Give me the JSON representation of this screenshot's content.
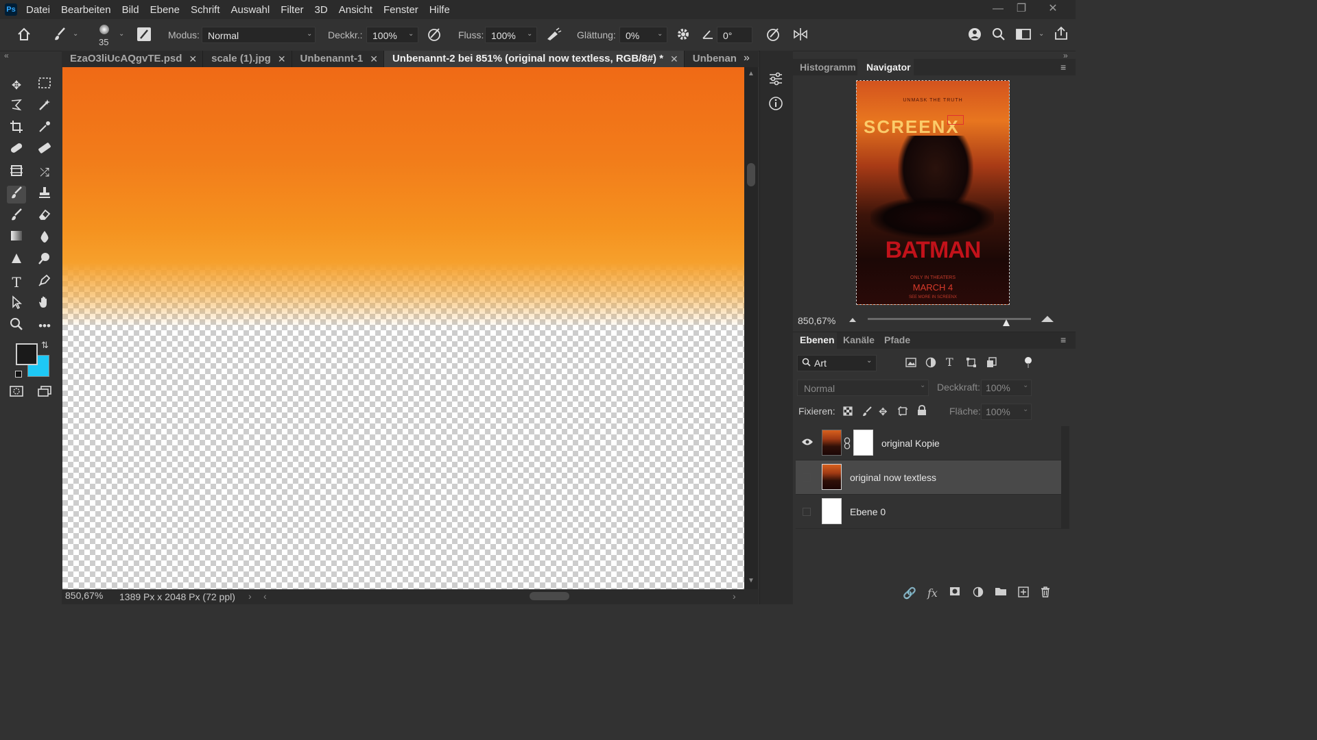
{
  "menu": {
    "app_logo": "Ps",
    "items": [
      "Datei",
      "Bearbeiten",
      "Bild",
      "Ebene",
      "Schrift",
      "Auswahl",
      "Filter",
      "3D",
      "Ansicht",
      "Fenster",
      "Hilfe"
    ]
  },
  "options": {
    "brush_size": "35",
    "mode_label": "Modus:",
    "mode_value": "Normal",
    "opacity_label": "Deckkr.:",
    "opacity_value": "100%",
    "flow_label": "Fluss:",
    "flow_value": "100%",
    "smoothing_label": "Glättung:",
    "smoothing_value": "0%",
    "angle_value": "0°"
  },
  "tabs": [
    {
      "label": "EzaO3liUcAQgvTE.psd"
    },
    {
      "label": "scale (1).jpg"
    },
    {
      "label": "Unbenannt-1"
    },
    {
      "label": "Unbenannt-2 bei 851% (original now textless, RGB/8#) *"
    },
    {
      "label": "Unbenan"
    }
  ],
  "status": {
    "zoom": "850,67%",
    "doc_size": "1389 Px x 2048 Px (72 ppl)"
  },
  "navigator": {
    "tab_histogram": "Histogramm",
    "tab_navigator": "Navigator",
    "zoom": "850,67%",
    "zoom_level": 0.85,
    "poster_text": {
      "tagline": "UNMASK THE TRUTH",
      "brand": "SCREENX",
      "title": "BATMAN",
      "subtitle": "ONLY IN THEATERS",
      "date": "MARCH 4",
      "footer": "SEE MORE IN SCREENX"
    }
  },
  "layers": {
    "tab_layers": "Ebenen",
    "tab_channels": "Kanäle",
    "tab_paths": "Pfade",
    "filter_kind": "Art",
    "blend_mode": "Normal",
    "opacity_label": "Deckkraft:",
    "opacity_value": "100%",
    "lock_label": "Fixieren:",
    "fill_label": "Fläche:",
    "fill_value": "100%",
    "items": [
      {
        "name": "original Kopie",
        "visible": true
      },
      {
        "name": "original now textless",
        "visible": false,
        "selected": true
      },
      {
        "name": "Ebene 0",
        "visible": false
      }
    ]
  },
  "colors": {
    "foreground": "#1a1a1a",
    "background": "#1ec8f5"
  }
}
